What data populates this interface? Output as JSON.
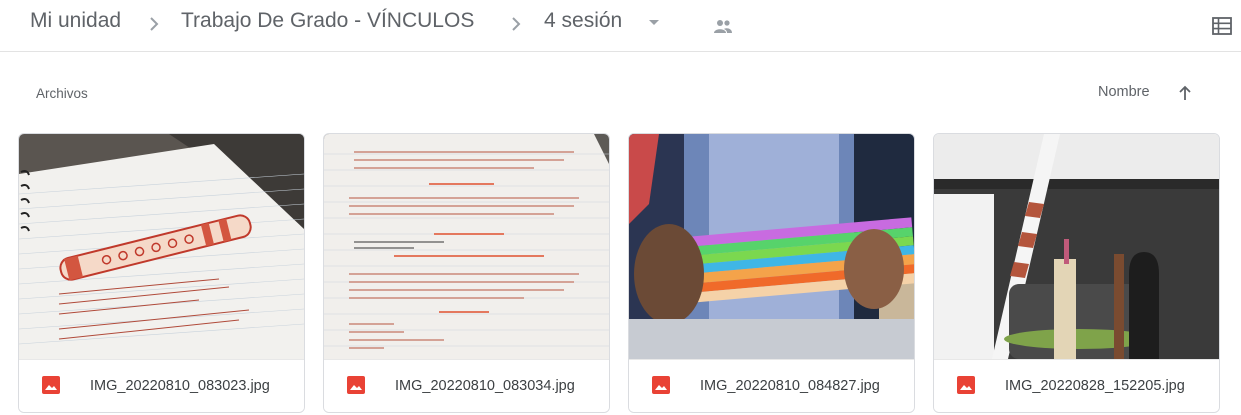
{
  "breadcrumb": {
    "root": "Mi unidad",
    "folder": "Trabajo De Grado - VÍNCULOS",
    "current": "4 sesión",
    "shared_icon": "people-icon",
    "view_icon": "list-view-icon"
  },
  "section": {
    "label": "Archivos"
  },
  "sort": {
    "label": "Nombre",
    "direction_icon": "arrow-up-icon"
  },
  "files": [
    {
      "name": "IMG_20220810_083023.jpg",
      "icon": "image-file-icon"
    },
    {
      "name": "IMG_20220810_083034.jpg",
      "icon": "image-file-icon"
    },
    {
      "name": "IMG_20220810_084827.jpg",
      "icon": "image-file-icon"
    },
    {
      "name": "IMG_20220828_152205.jpg",
      "icon": "image-file-icon"
    }
  ],
  "colors": {
    "image_icon": "#e94235",
    "text": "#5f6368",
    "divider": "#e3e3e3"
  }
}
